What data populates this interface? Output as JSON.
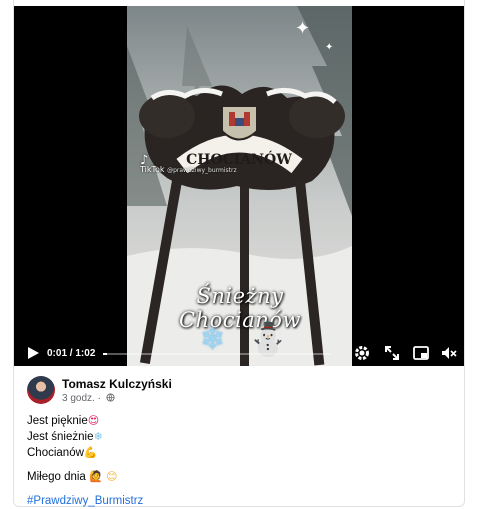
{
  "video": {
    "tiktok_logo": "TikTok",
    "tiktok_handle": "@prawdziwy_burmistrz",
    "sign_text": "CHOCIANÓW",
    "title_overlay": "Śnieżny Chocianów",
    "current_time": "0:01",
    "separator": " / ",
    "duration": "1:02",
    "progress": 0.016,
    "icons": [
      "play-icon",
      "settings-icon",
      "fullscreen-icon",
      "picture-in-picture-icon",
      "volume-muted-icon"
    ]
  },
  "post": {
    "author": "Tomasz Kulczyński",
    "timestamp": "3 godz.",
    "timestamp_separator": " · ",
    "visibility_icon": "globe-icon",
    "lines": [
      {
        "text": "Jest pięknie",
        "emoji": "😍"
      },
      {
        "text": "Jest śnieżnie",
        "emoji": "❄"
      },
      {
        "text": "Chocianów",
        "emoji": "💪"
      }
    ],
    "greeting": "Miłego dnia",
    "greeting_emojis": [
      "🙋",
      "😊"
    ],
    "hashtag": "#Prawdziwy_Burmistrz"
  }
}
